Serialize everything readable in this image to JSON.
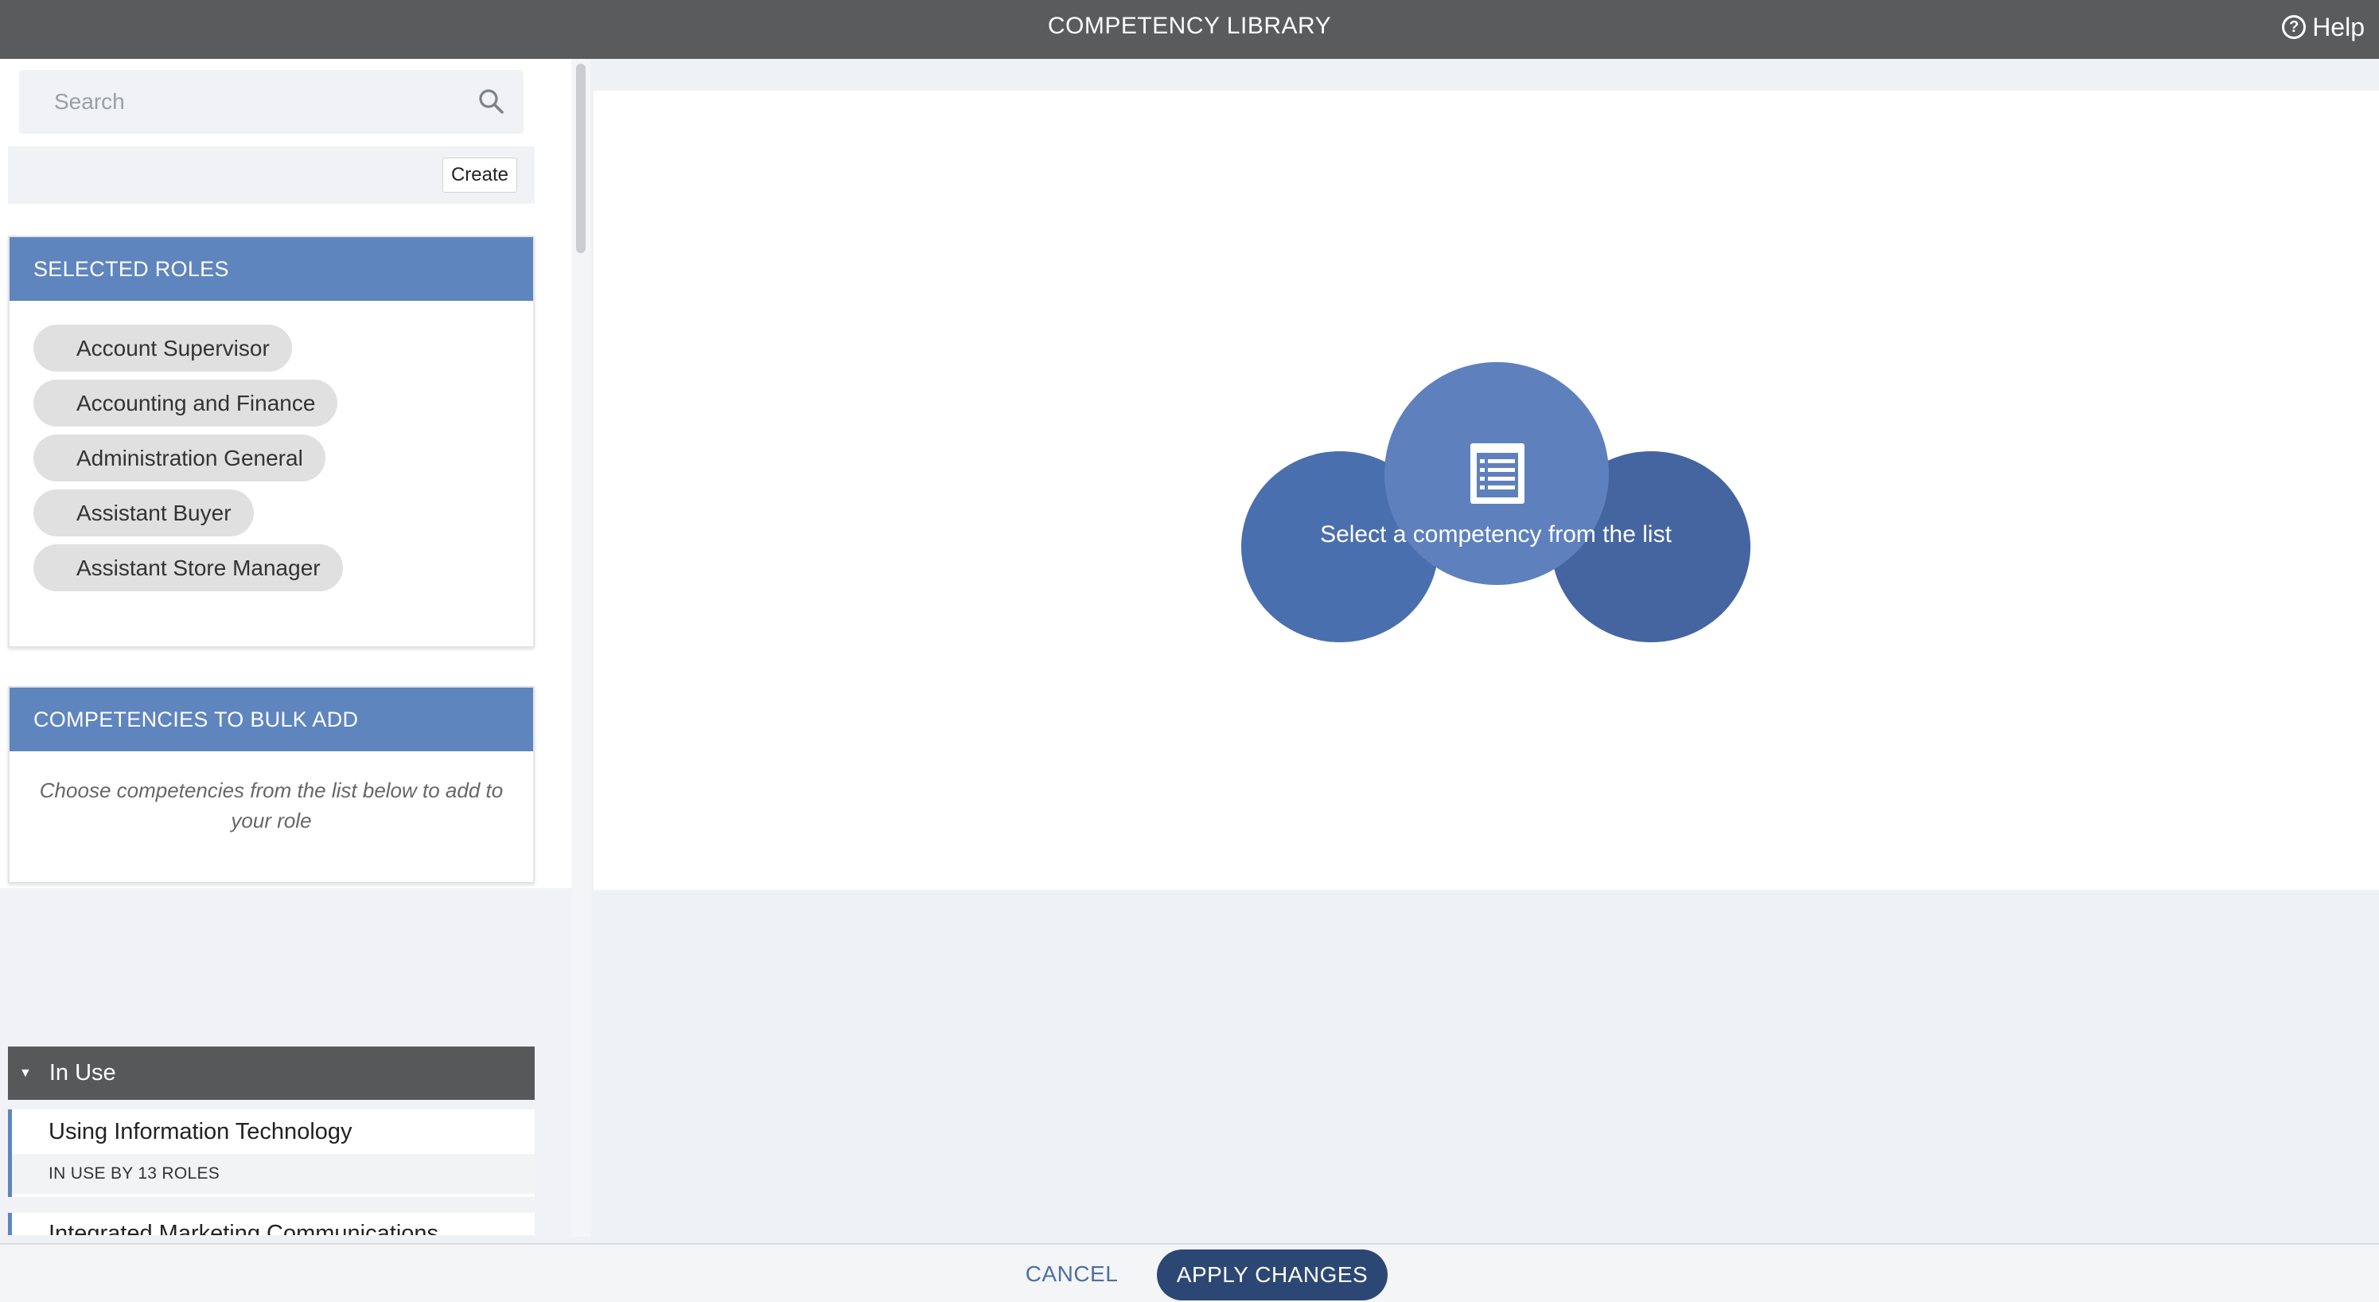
{
  "header": {
    "title": "COMPETENCY LIBRARY",
    "help_label": "Help",
    "help_icon": "question-circle-icon"
  },
  "search": {
    "placeholder": "Search",
    "value": "",
    "icon": "magnifier-icon"
  },
  "toolbar": {
    "create_label": "Create"
  },
  "selected_roles": {
    "title": "SELECTED ROLES",
    "roles": [
      "Account Supervisor",
      "Accounting and Finance",
      "Administration General",
      "Assistant Buyer",
      "Assistant Store Manager"
    ]
  },
  "bulk_add": {
    "title": "COMPETENCIES TO BULK ADD",
    "instruction": "Choose competencies from the list below to add to your role"
  },
  "in_use": {
    "group_label": "In Use",
    "items": [
      {
        "name": "Using Information Technology",
        "usage": "IN USE BY 13 ROLES"
      },
      {
        "name": "Integrated Marketing Communications"
      }
    ]
  },
  "empty_state": {
    "message": "Select a competency from the list",
    "icon": "list-document-icon"
  },
  "footer": {
    "cancel_label": "CANCEL",
    "apply_label": "APPLY CHANGES"
  },
  "colors": {
    "header_bg": "#5a5b5d",
    "card_header": "#5f85bf",
    "group_header": "#575859",
    "primary_button": "#2c4773",
    "link": "#4e6ea6"
  }
}
